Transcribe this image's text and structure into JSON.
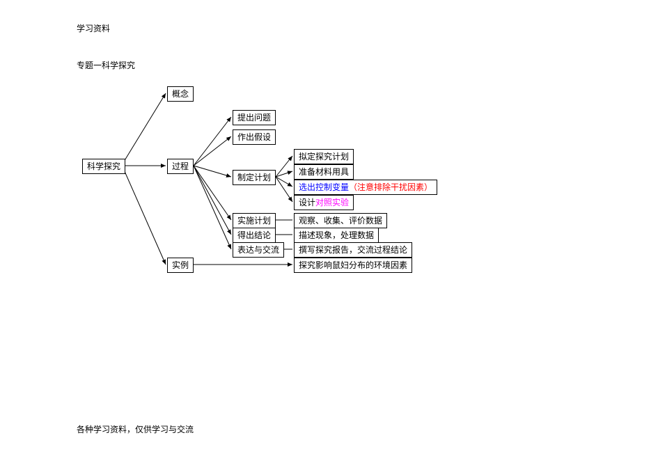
{
  "header": "学习资料",
  "title": "专题一科学探究",
  "footer": "各种学习资料，仅供学习与交流",
  "root": "科学探究",
  "level1": {
    "concept": "概念",
    "process": "过程",
    "example": "实例"
  },
  "level2": {
    "ask_question": "提出问题",
    "make_hypothesis": "作出假设",
    "make_plan": "制定计划",
    "execute_plan": "实施计划",
    "draw_conclusion": "得出结论",
    "express_exchange": "表达与交流"
  },
  "level3": {
    "draft_plan": "拟定探究计划",
    "prepare_materials": "准备材料用具",
    "select_variables_blue": "选出控制变量",
    "select_variables_red": "（注意排除干扰因素）",
    "design_prefix": "设计",
    "design_magenta": "对照实验",
    "observe_collect": "观察、收集、评价数据",
    "describe_process": "描述现象，处理数据",
    "write_report": "撰写探究报告，交流过程结论",
    "example_detail": "探究影响鼠妇分布的环境因素"
  }
}
